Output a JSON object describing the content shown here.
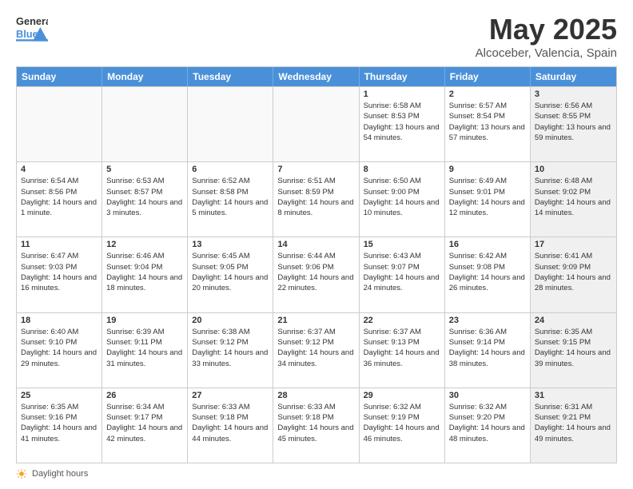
{
  "header": {
    "logo_general": "General",
    "logo_blue": "Blue",
    "month_title": "May 2025",
    "location": "Alcoceber, Valencia, Spain"
  },
  "footer": {
    "daylight_label": "Daylight hours"
  },
  "weekdays": [
    "Sunday",
    "Monday",
    "Tuesday",
    "Wednesday",
    "Thursday",
    "Friday",
    "Saturday"
  ],
  "weeks": [
    [
      {
        "day": "",
        "empty": true
      },
      {
        "day": "",
        "empty": true
      },
      {
        "day": "",
        "empty": true
      },
      {
        "day": "",
        "empty": true
      },
      {
        "day": "1",
        "sunrise": "6:58 AM",
        "sunset": "8:53 PM",
        "daylight": "13 hours and 54 minutes."
      },
      {
        "day": "2",
        "sunrise": "6:57 AM",
        "sunset": "8:54 PM",
        "daylight": "13 hours and 57 minutes."
      },
      {
        "day": "3",
        "sunrise": "6:56 AM",
        "sunset": "8:55 PM",
        "daylight": "13 hours and 59 minutes.",
        "shaded": true
      }
    ],
    [
      {
        "day": "4",
        "sunrise": "6:54 AM",
        "sunset": "8:56 PM",
        "daylight": "14 hours and 1 minute."
      },
      {
        "day": "5",
        "sunrise": "6:53 AM",
        "sunset": "8:57 PM",
        "daylight": "14 hours and 3 minutes."
      },
      {
        "day": "6",
        "sunrise": "6:52 AM",
        "sunset": "8:58 PM",
        "daylight": "14 hours and 5 minutes."
      },
      {
        "day": "7",
        "sunrise": "6:51 AM",
        "sunset": "8:59 PM",
        "daylight": "14 hours and 8 minutes."
      },
      {
        "day": "8",
        "sunrise": "6:50 AM",
        "sunset": "9:00 PM",
        "daylight": "14 hours and 10 minutes."
      },
      {
        "day": "9",
        "sunrise": "6:49 AM",
        "sunset": "9:01 PM",
        "daylight": "14 hours and 12 minutes."
      },
      {
        "day": "10",
        "sunrise": "6:48 AM",
        "sunset": "9:02 PM",
        "daylight": "14 hours and 14 minutes.",
        "shaded": true
      }
    ],
    [
      {
        "day": "11",
        "sunrise": "6:47 AM",
        "sunset": "9:03 PM",
        "daylight": "14 hours and 16 minutes."
      },
      {
        "day": "12",
        "sunrise": "6:46 AM",
        "sunset": "9:04 PM",
        "daylight": "14 hours and 18 minutes."
      },
      {
        "day": "13",
        "sunrise": "6:45 AM",
        "sunset": "9:05 PM",
        "daylight": "14 hours and 20 minutes."
      },
      {
        "day": "14",
        "sunrise": "6:44 AM",
        "sunset": "9:06 PM",
        "daylight": "14 hours and 22 minutes."
      },
      {
        "day": "15",
        "sunrise": "6:43 AM",
        "sunset": "9:07 PM",
        "daylight": "14 hours and 24 minutes."
      },
      {
        "day": "16",
        "sunrise": "6:42 AM",
        "sunset": "9:08 PM",
        "daylight": "14 hours and 26 minutes."
      },
      {
        "day": "17",
        "sunrise": "6:41 AM",
        "sunset": "9:09 PM",
        "daylight": "14 hours and 28 minutes.",
        "shaded": true
      }
    ],
    [
      {
        "day": "18",
        "sunrise": "6:40 AM",
        "sunset": "9:10 PM",
        "daylight": "14 hours and 29 minutes."
      },
      {
        "day": "19",
        "sunrise": "6:39 AM",
        "sunset": "9:11 PM",
        "daylight": "14 hours and 31 minutes."
      },
      {
        "day": "20",
        "sunrise": "6:38 AM",
        "sunset": "9:12 PM",
        "daylight": "14 hours and 33 minutes."
      },
      {
        "day": "21",
        "sunrise": "6:37 AM",
        "sunset": "9:12 PM",
        "daylight": "14 hours and 34 minutes."
      },
      {
        "day": "22",
        "sunrise": "6:37 AM",
        "sunset": "9:13 PM",
        "daylight": "14 hours and 36 minutes."
      },
      {
        "day": "23",
        "sunrise": "6:36 AM",
        "sunset": "9:14 PM",
        "daylight": "14 hours and 38 minutes."
      },
      {
        "day": "24",
        "sunrise": "6:35 AM",
        "sunset": "9:15 PM",
        "daylight": "14 hours and 39 minutes.",
        "shaded": true
      }
    ],
    [
      {
        "day": "25",
        "sunrise": "6:35 AM",
        "sunset": "9:16 PM",
        "daylight": "14 hours and 41 minutes."
      },
      {
        "day": "26",
        "sunrise": "6:34 AM",
        "sunset": "9:17 PM",
        "daylight": "14 hours and 42 minutes."
      },
      {
        "day": "27",
        "sunrise": "6:33 AM",
        "sunset": "9:18 PM",
        "daylight": "14 hours and 44 minutes."
      },
      {
        "day": "28",
        "sunrise": "6:33 AM",
        "sunset": "9:18 PM",
        "daylight": "14 hours and 45 minutes."
      },
      {
        "day": "29",
        "sunrise": "6:32 AM",
        "sunset": "9:19 PM",
        "daylight": "14 hours and 46 minutes."
      },
      {
        "day": "30",
        "sunrise": "6:32 AM",
        "sunset": "9:20 PM",
        "daylight": "14 hours and 48 minutes."
      },
      {
        "day": "31",
        "sunrise": "6:31 AM",
        "sunset": "9:21 PM",
        "daylight": "14 hours and 49 minutes.",
        "shaded": true
      }
    ]
  ]
}
